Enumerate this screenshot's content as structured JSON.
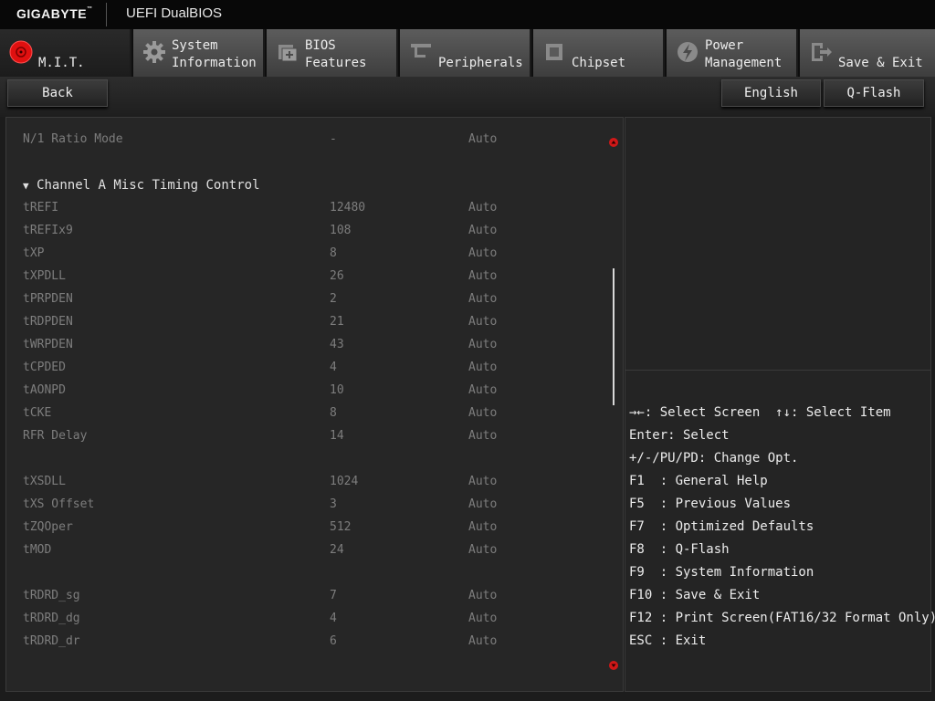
{
  "brand": {
    "name": "GIGABYTE",
    "tm": "™",
    "product": "UEFI DualBIOS"
  },
  "tabs": [
    {
      "line1": "",
      "line2": "M.I.T.",
      "icon": "mit-icon"
    },
    {
      "line1": "System",
      "line2": "Information",
      "icon": "gear-icon"
    },
    {
      "line1": "BIOS",
      "line2": "Features",
      "icon": "bios-chip-icon"
    },
    {
      "line1": "",
      "line2": "Peripherals",
      "icon": "peripherals-icon"
    },
    {
      "line1": "",
      "line2": "Chipset",
      "icon": "chipset-icon"
    },
    {
      "line1": "Power",
      "line2": "Management",
      "icon": "power-icon"
    },
    {
      "line1": "",
      "line2": "Save & Exit",
      "icon": "exit-icon"
    }
  ],
  "toolbar": {
    "back": "Back",
    "language": "English",
    "qflash": "Q-Flash"
  },
  "top_row": {
    "name": "N/1 Ratio Mode",
    "value": "-",
    "mode": "Auto"
  },
  "section": {
    "arrow": "▼",
    "title": "Channel A Misc Timing Control"
  },
  "rows": [
    {
      "name": "tREFI",
      "value": "12480",
      "mode": "Auto"
    },
    {
      "name": "tREFIx9",
      "value": "108",
      "mode": "Auto"
    },
    {
      "name": "tXP",
      "value": "8",
      "mode": "Auto"
    },
    {
      "name": "tXPDLL",
      "value": "26",
      "mode": "Auto"
    },
    {
      "name": "tPRPDEN",
      "value": "2",
      "mode": "Auto"
    },
    {
      "name": "tRDPDEN",
      "value": "21",
      "mode": "Auto"
    },
    {
      "name": "tWRPDEN",
      "value": "43",
      "mode": "Auto"
    },
    {
      "name": "tCPDED",
      "value": "4",
      "mode": "Auto"
    },
    {
      "name": "tAONPD",
      "value": "10",
      "mode": "Auto"
    },
    {
      "name": "tCKE",
      "value": "8",
      "mode": "Auto"
    },
    {
      "name": "RFR Delay",
      "value": "14",
      "mode": "Auto"
    },
    {
      "name": "tXSDLL",
      "value": "1024",
      "mode": "Auto"
    },
    {
      "name": "tXS Offset",
      "value": "3",
      "mode": "Auto"
    },
    {
      "name": "tZQOper",
      "value": "512",
      "mode": "Auto"
    },
    {
      "name": "tMOD",
      "value": "24",
      "mode": "Auto"
    },
    {
      "name": "tRDRD_sg",
      "value": "7",
      "mode": "Auto"
    },
    {
      "name": "tRDRD_dg",
      "value": "4",
      "mode": "Auto"
    },
    {
      "name": "tRDRD_dr",
      "value": "6",
      "mode": "Auto"
    }
  ],
  "help": [
    "→←: Select Screen  ↑↓: Select Item",
    "Enter: Select",
    "+/-/PU/PD: Change Opt.",
    "F1  : General Help",
    "F5  : Previous Values",
    "F7  : Optimized Defaults",
    "F8  : Q-Flash",
    "F9  : System Information",
    "F10 : Save & Exit",
    "F12 : Print Screen(FAT16/32 Format Only)",
    "ESC : Exit"
  ],
  "colors": {
    "accent_red": "#e01010",
    "label_grey": "#7d7d7d",
    "text_white": "#ececec"
  }
}
